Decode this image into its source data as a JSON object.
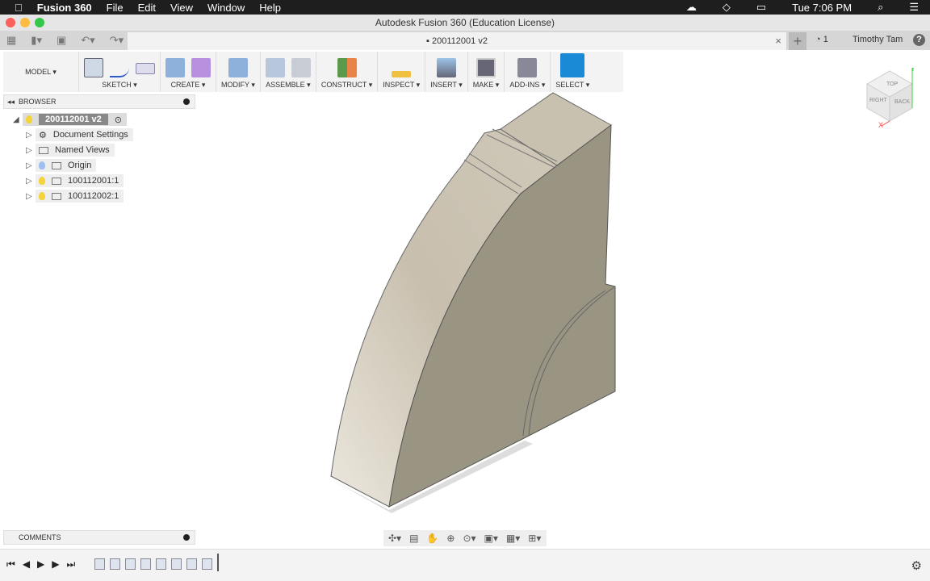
{
  "menubar": {
    "app": "Fusion 360",
    "items": [
      "File",
      "Edit",
      "View",
      "Window",
      "Help"
    ],
    "clock": "Tue 7:06 PM"
  },
  "window": {
    "title": "Autodesk Fusion 360 (Education License)"
  },
  "tab": {
    "label": "200112001 v2"
  },
  "header": {
    "notifications": "1",
    "user": "Timothy Tam",
    "help": "?"
  },
  "toolbar": {
    "workspace": "MODEL ▾",
    "groups": [
      "SKETCH ▾",
      "CREATE ▾",
      "MODIFY ▾",
      "ASSEMBLE ▾",
      "CONSTRUCT ▾",
      "INSPECT ▾",
      "INSERT ▾",
      "MAKE ▾",
      "ADD-INS ▾",
      "SELECT ▾"
    ]
  },
  "browser": {
    "title": "BROWSER",
    "root": "200112001 v2",
    "items": [
      "Document Settings",
      "Named Views",
      "Origin",
      "100112001:1",
      "100112002:1"
    ]
  },
  "comments": {
    "title": "COMMENTS"
  },
  "viewcube": {
    "top": "TOP",
    "right": "RIGHT",
    "back": "BACK",
    "x": "X",
    "y": "Y"
  },
  "colors": {
    "accent": "#1a8ad6",
    "select_bg": "#1a8ad6",
    "face_light": "#d0c8b8",
    "face_dark": "#9a9482"
  }
}
